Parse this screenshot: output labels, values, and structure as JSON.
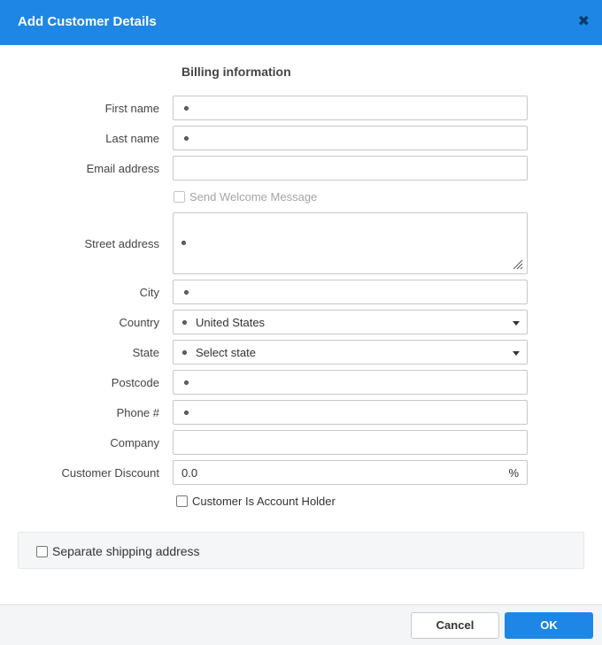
{
  "dialog": {
    "title": "Add Customer Details",
    "close_icon": "close-icon"
  },
  "billing": {
    "section_title": "Billing information",
    "first_name": {
      "label": "First name",
      "value": ""
    },
    "last_name": {
      "label": "Last name",
      "value": ""
    },
    "email": {
      "label": "Email address",
      "value": ""
    },
    "send_welcome": {
      "label": "Send Welcome Message",
      "checked": false,
      "disabled": true
    },
    "street": {
      "label": "Street address",
      "value": ""
    },
    "city": {
      "label": "City",
      "value": ""
    },
    "country": {
      "label": "Country",
      "value": "United States"
    },
    "state": {
      "label": "State",
      "value": "Select state"
    },
    "postcode": {
      "label": "Postcode",
      "value": ""
    },
    "phone": {
      "label": "Phone #",
      "value": ""
    },
    "company": {
      "label": "Company",
      "value": ""
    },
    "discount": {
      "label": "Customer Discount",
      "value": "0.0",
      "suffix": "%"
    },
    "account_holder": {
      "label": "Customer Is Account Holder",
      "checked": false
    }
  },
  "shipping": {
    "label": "Separate shipping address",
    "checked": false
  },
  "footer": {
    "cancel_label": "Cancel",
    "ok_label": "OK"
  },
  "colors": {
    "accent": "#1e87e5",
    "close_icon": "#0d3a66"
  }
}
